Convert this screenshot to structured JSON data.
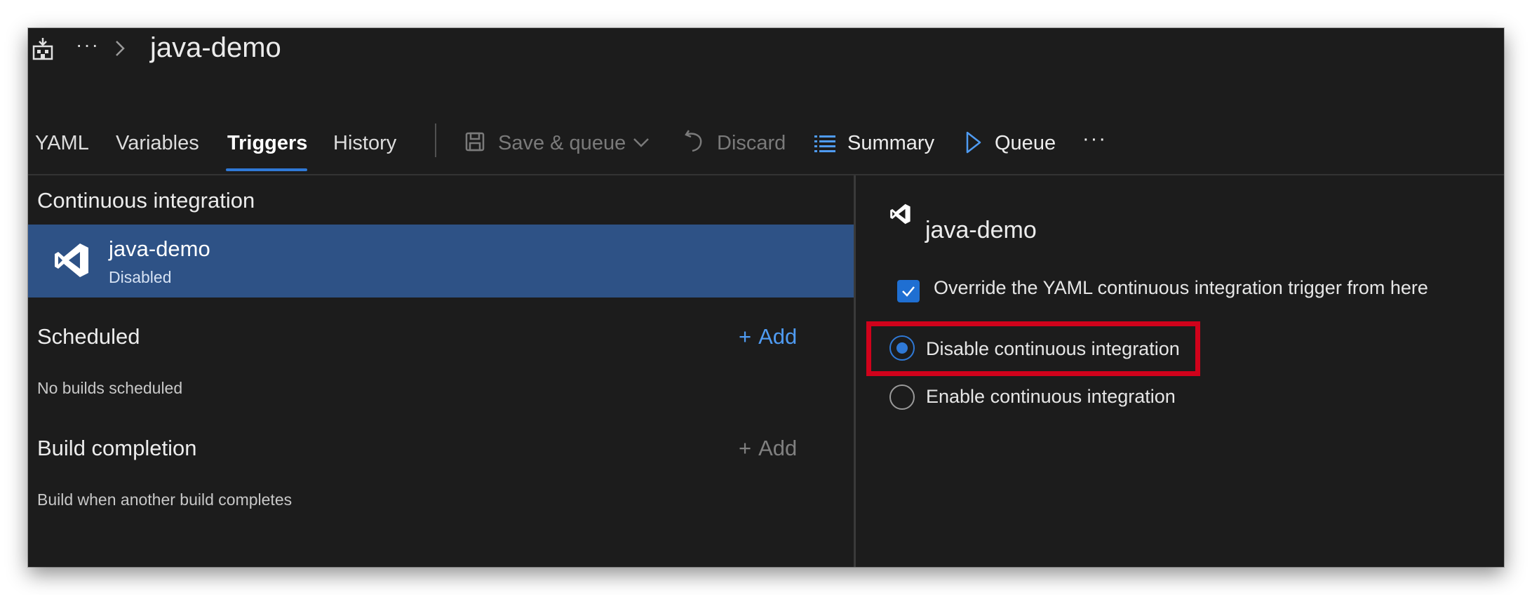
{
  "header": {
    "title": "java-demo",
    "breadcrumb_more": "···",
    "icons": {
      "pipeline": "pipeline-icon",
      "chevron": "chevron-right-icon"
    }
  },
  "tabs": [
    {
      "label": "YAML",
      "active": false
    },
    {
      "label": "Variables",
      "active": false
    },
    {
      "label": "Triggers",
      "active": true
    },
    {
      "label": "History",
      "active": false
    }
  ],
  "toolbar": {
    "save_queue": "Save & queue",
    "discard": "Discard",
    "summary": "Summary",
    "queue": "Queue",
    "more": "···"
  },
  "left_panel": {
    "ci": {
      "title": "Continuous integration",
      "item_name": "java-demo",
      "item_status": "Disabled"
    },
    "scheduled": {
      "title": "Scheduled",
      "add_label": "Add",
      "description": "No builds scheduled"
    },
    "build_completion": {
      "title": "Build completion",
      "add_label": "Add",
      "description": "Build when another build completes"
    }
  },
  "right_panel": {
    "title": "java-demo",
    "override_label": "Override the YAML continuous integration trigger from here",
    "override_checked": true,
    "options": [
      {
        "label": "Disable continuous integration",
        "selected": true
      },
      {
        "label": "Enable continuous integration",
        "selected": false
      }
    ]
  },
  "colors": {
    "accent": "#2f79d6",
    "selected_row": "#2e5286",
    "highlight": "#d0021b",
    "background": "#1c1c1c"
  }
}
